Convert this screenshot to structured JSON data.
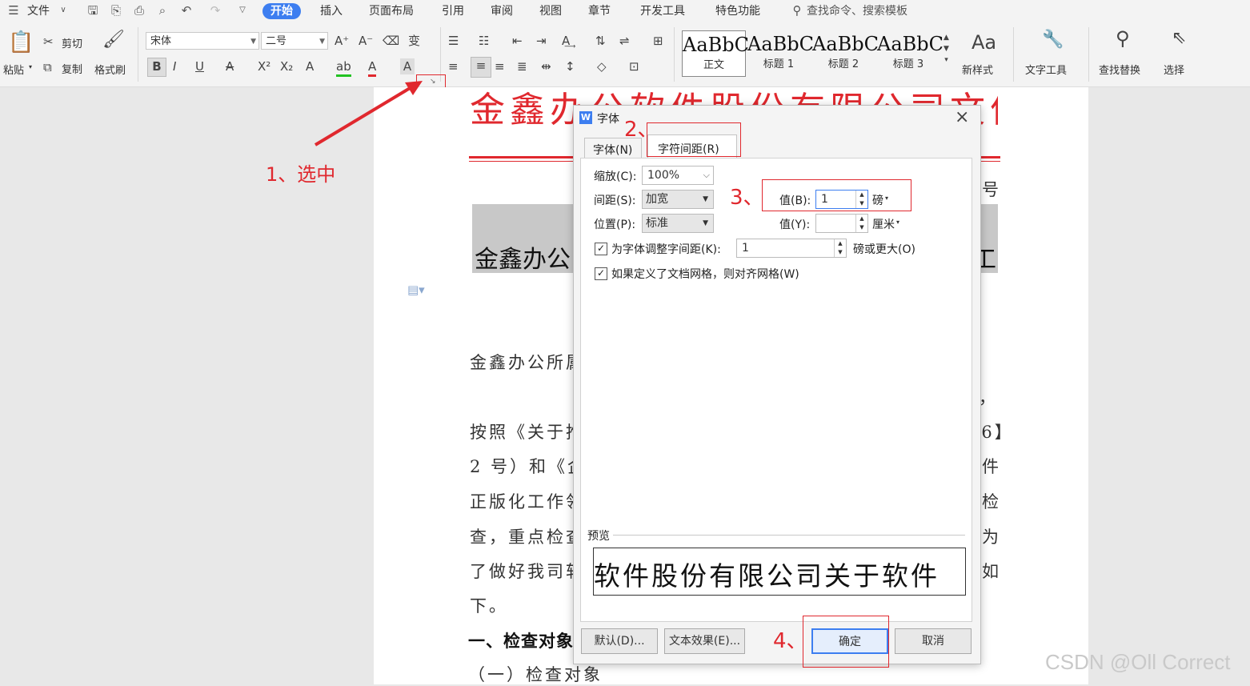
{
  "menubar": {
    "file_label": "文件",
    "tabs": [
      {
        "label": "开始",
        "active": true
      },
      {
        "label": "插入"
      },
      {
        "label": "页面布局"
      },
      {
        "label": "引用"
      },
      {
        "label": "审阅"
      },
      {
        "label": "视图"
      },
      {
        "label": "章节"
      },
      {
        "label": "开发工具"
      },
      {
        "label": "特色功能"
      }
    ],
    "search_text": "查找命令、搜索模板"
  },
  "ribbon": {
    "paste": "粘贴",
    "cut": "剪切",
    "copy": "复制",
    "format_painter": "格式刷",
    "font_name": "宋体",
    "font_size": "二号",
    "styles": [
      {
        "preview": "AaBbC",
        "label": "正文"
      },
      {
        "preview": "AaBbC",
        "label": "标题 1"
      },
      {
        "preview": "AaBbC",
        "label": "标题 2"
      },
      {
        "preview": "AaBbC",
        "label": "标题 3"
      }
    ],
    "new_style": "新样式",
    "text_tools": "文字工具",
    "find_replace": "查找替换",
    "select": "选择"
  },
  "document": {
    "header_title": "金鑫办公软件股份有限公司文件",
    "number_fragment": "号",
    "heading_left": "金鑫办公",
    "heading_right": "工",
    "lines": [
      {
        "left": "金鑫办公所属",
        "right": ""
      },
      {
        "left": "",
        "right": "，"
      },
      {
        "left": "按照《关于推",
        "right": "06】"
      },
      {
        "left": "2 号）和《企",
        "right": "件"
      },
      {
        "left": "正版化工作领",
        "right": "检"
      },
      {
        "left": "查，重点检查",
        "right": "为"
      },
      {
        "left": "了做好我司软",
        "right": "如"
      },
      {
        "left": "下。",
        "right": ""
      }
    ],
    "section1": "一、检查对象",
    "section1_sub": "（一）检查对象"
  },
  "dialog": {
    "title": "字体",
    "close": "×",
    "tabs": [
      {
        "label": "字体(N)",
        "active": false
      },
      {
        "label": "字符间距(R)",
        "active": true
      }
    ],
    "scale_label": "缩放(C):",
    "scale_value": "100%",
    "spacing_label": "间距(S):",
    "spacing_value": "加宽",
    "spacing_amount_label": "值(B):",
    "spacing_amount_value": "1",
    "spacing_unit": "磅",
    "position_label": "位置(P):",
    "position_value": "标准",
    "position_amount_label": "值(Y):",
    "position_amount_value": "",
    "position_unit": "厘米",
    "kerning_label": "为字体调整字间距(K):",
    "kerning_value": "1",
    "kerning_suffix": "磅或更大(O)",
    "kerning_checked": true,
    "grid_label": "如果定义了文档网格，则对齐网格(W)",
    "grid_checked": true,
    "preview_label": "预览",
    "preview_text": "软件股份有限公司关于软件",
    "default_button": "默认(D)...",
    "text_effect_button": "文本效果(E)...",
    "ok_button": "确定",
    "cancel_button": "取消"
  },
  "annotations": {
    "step1": "1、选中",
    "step2": "2、",
    "step3": "3、",
    "step4": "4、",
    "color": "#e0282e"
  },
  "watermark": "CSDN @Oll Correct"
}
